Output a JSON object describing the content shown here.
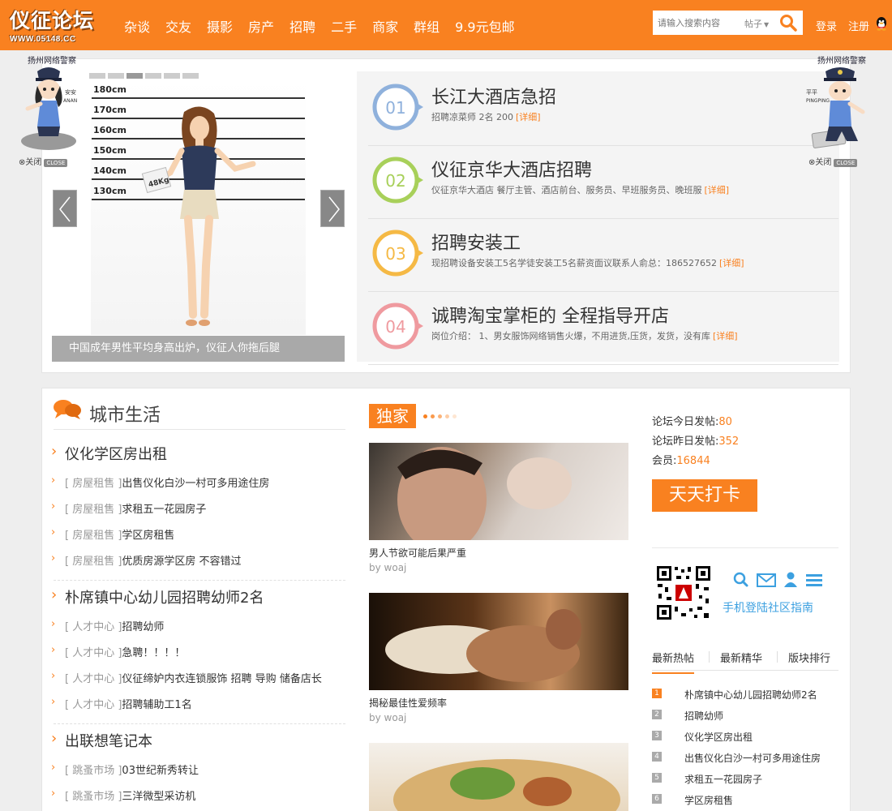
{
  "header": {
    "logo_title": "仪征论坛",
    "logo_url": "WWW.05148.CC",
    "nav": [
      "杂谈",
      "交友",
      "摄影",
      "房产",
      "招聘",
      "二手",
      "商家",
      "群组",
      "9.9元包邮"
    ],
    "search_placeholder": "请输入搜索内容",
    "search_type": "帖子",
    "login": "登录",
    "register": "注册"
  },
  "police": {
    "left_org": "扬州网络警察",
    "left_name": "安安",
    "left_name_py": "ANAN",
    "right_org": "扬州网络警察",
    "right_name": "平平",
    "right_name_py": "PINGPING",
    "close_label": "关闭",
    "close_badge": "CLOSE"
  },
  "slider": {
    "caption": "中国成年男性平均身高出炉，仪征人你拖后腿",
    "height_marks": [
      "180cm",
      "170cm",
      "160cm",
      "150cm",
      "140cm",
      "130cm"
    ],
    "weight_tag": "48Kg"
  },
  "jobs": [
    {
      "num": "01",
      "title": "长江大酒店急招",
      "desc": "招聘凉菜师 2名 200",
      "link": "[详细]",
      "color": "#8fb1dc"
    },
    {
      "num": "02",
      "title": "仪征京华大酒店招聘",
      "desc": "仪征京华大酒店 餐厅主管、酒店前台、服务员、早班服务员、晚班服",
      "link": "[详细]",
      "color": "#a8d05a"
    },
    {
      "num": "03",
      "title": "招聘安装工",
      "desc": "现招聘设备安装工5名学徒安装工5名薪资面议联系人俞总：186527652",
      "link": "[详细]",
      "color": "#f5b945"
    },
    {
      "num": "04",
      "title": "诚聘淘宝掌柜的 全程指导开店",
      "desc": "岗位介绍： 1、男女服饰网络销售火爆，不用进货,压货，发货，没有库",
      "link": "[详细]",
      "color": "#ef9a9f"
    }
  ],
  "city": {
    "title": "城市生活",
    "groups": [
      {
        "title": "仪化学区房出租",
        "items": [
          {
            "tag": "[ 房屋租售 ]",
            "text": "出售仪化白沙一村可多用途住房"
          },
          {
            "tag": "[ 房屋租售 ]",
            "text": "求租五一花园房子"
          },
          {
            "tag": "[ 房屋租售 ]",
            "text": "学区房租售"
          },
          {
            "tag": "[ 房屋租售 ]",
            "text": "优质房源学区房 不容错过"
          }
        ]
      },
      {
        "title": "朴席镇中心幼儿园招聘幼师2名",
        "items": [
          {
            "tag": "[ 人才中心 ]",
            "text": "招聘幼师"
          },
          {
            "tag": "[ 人才中心 ]",
            "text": "急聘！！！！"
          },
          {
            "tag": "[ 人才中心 ]",
            "text": "仪征缔妒内衣连锁服饰 招聘 导购 储备店长"
          },
          {
            "tag": "[ 人才中心 ]",
            "text": "招聘辅助工1名"
          }
        ]
      },
      {
        "title": "出联想笔记本",
        "items": [
          {
            "tag": "[ 跳蚤市场 ]",
            "text": "03世纪新秀转让"
          },
          {
            "tag": "[ 跳蚤市场 ]",
            "text": "三洋微型采访机"
          }
        ]
      }
    ]
  },
  "exclusive": {
    "label": "独家",
    "items": [
      {
        "caption": "男人节欲可能后果严重",
        "by": "by woaj"
      },
      {
        "caption": "揭秘最佳性爱频率",
        "by": "by woaj"
      }
    ]
  },
  "stats": {
    "today_label": "论坛今日发帖:",
    "today": "80",
    "yesterday_label": "论坛昨日发帖:",
    "yesterday": "352",
    "members_label": "会员:",
    "members": "16844"
  },
  "checkin": "天天打卡",
  "mobile_guide": "手机登陆社区指南",
  "tabs": [
    "最新热帖",
    "最新精华",
    "版块排行"
  ],
  "ranking": [
    {
      "n": "1",
      "text": "朴席镇中心幼儿园招聘幼师2名"
    },
    {
      "n": "2",
      "text": "招聘幼师"
    },
    {
      "n": "3",
      "text": "仪化学区房出租"
    },
    {
      "n": "4",
      "text": "出售仪化白沙一村可多用途住房"
    },
    {
      "n": "5",
      "text": "求租五一花园房子"
    },
    {
      "n": "6",
      "text": "学区房租售"
    }
  ],
  "colors": {
    "brand": "#f98120",
    "link_blue": "#3ca0e0"
  }
}
